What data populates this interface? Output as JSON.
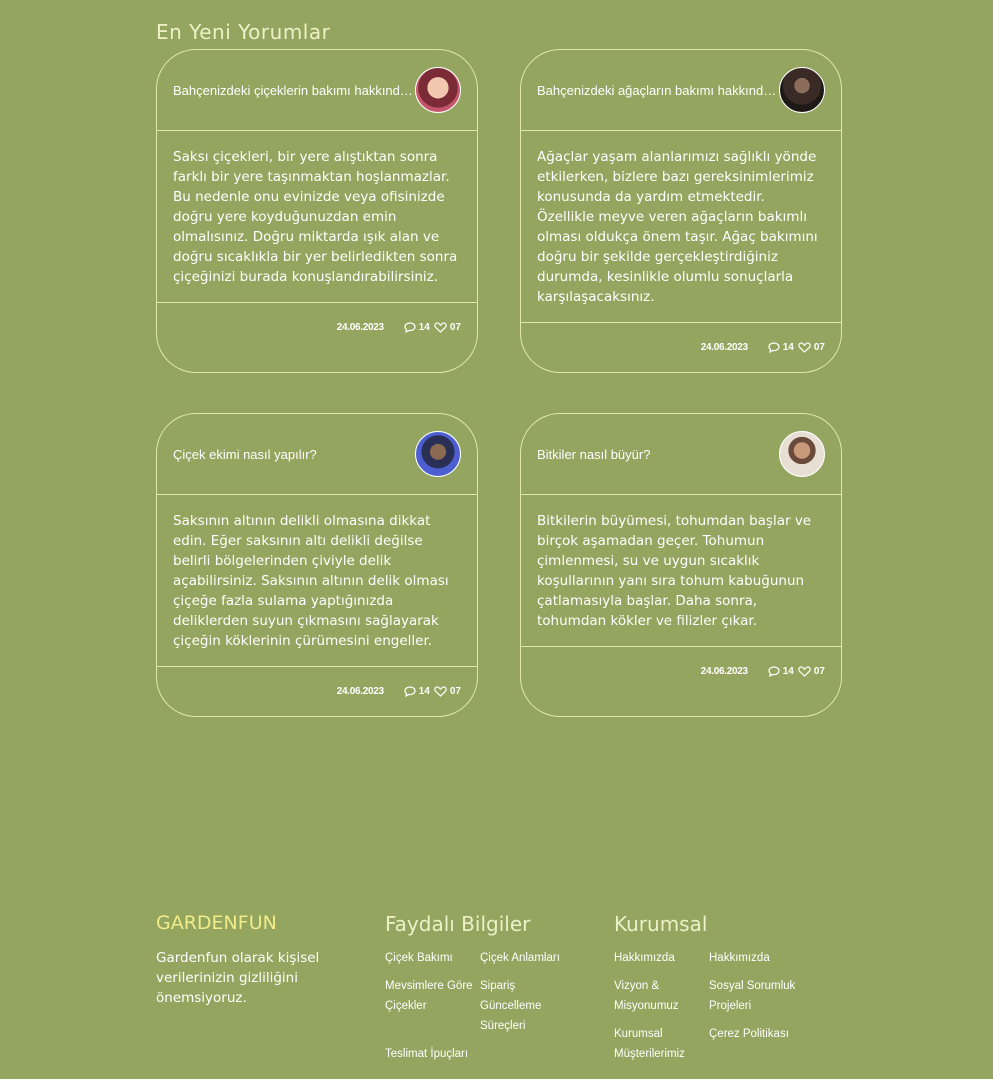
{
  "section": {
    "title": "En Yeni Yorumlar"
  },
  "cards": [
    {
      "title": "Bahçenizdeki çiçeklerin bakımı hakkında...",
      "avatar_color": "#c4556a",
      "body": "Saksı çiçekleri, bir yere alıştıktan sonra farklı bir yere taşınmaktan hoşlanmazlar. Bu nedenle onu evinizde veya ofisinizde doğru yere koyduğunuzdan emin olmalısınız. Doğru miktarda ışık alan ve doğru sıcaklıkla bir yer belirledikten sonra çiçeğinizi burada konuşlandırabilirsiniz.",
      "date": "24.06.2023",
      "comments": "14",
      "likes": "07"
    },
    {
      "title": "Bahçenizdeki ağaçların bakımı hakkında...",
      "avatar_color": "#2a2222",
      "body": "Ağaçlar yaşam alanlarımızı sağlıklı yönde etkilerken, bizlere bazı gereksinimlerimiz konusunda da yardım etmektedir. Özellikle meyve veren ağaçların bakımlı olması oldukça önem taşır. Ağaç bakımını doğru bir şekilde gerçekleştirdiğiniz durumda, kesinlikle olumlu sonuçlarla karşılaşacaksınız.",
      "date": "24.06.2023",
      "comments": "14",
      "likes": "07"
    },
    {
      "title": "Çiçek ekimi nasıl yapılır?",
      "avatar_color": "#3a4aa0",
      "body": "Saksının altının delikli olmasına dikkat edin. Eğer saksının altı delikli değilse belirli bölgelerinden çiviyle delik açabilirsiniz. Saksının altının delik olması çiçeğe fazla sulama yaptığınızda deliklerden suyun çıkmasını sağlayarak çiçeğin köklerinin çürümesini engeller.",
      "date": "24.06.2023",
      "comments": "14",
      "likes": "07"
    },
    {
      "title": "Bitkiler nasıl büyür?",
      "avatar_color": "#d9c9b5",
      "body": "Bitkilerin büyümesi, tohumdan başlar ve birçok aşamadan geçer. Tohumun çimlenmesi, su ve uygun sıcaklık koşullarının yanı sıra tohum kabuğunun çatlamasıyla başlar. Daha sonra, tohumdan kökler ve filizler çıkar.",
      "date": "24.06.2023",
      "comments": "14",
      "likes": "07"
    }
  ],
  "footer": {
    "brand": "GARDENFUN",
    "description": "Gardenfun olarak kişisel verilerinizin gizliliğini önemsiyoruz.",
    "useful": {
      "title": "Faydalı Bilgiler",
      "links": [
        "Çiçek Bakımı",
        "Çiçek Anlamları",
        "Mevsimlere Göre Çiçekler",
        "Sipariş Güncelleme Süreçleri",
        "Teslimat İpuçları"
      ]
    },
    "corporate": {
      "title": "Kurumsal",
      "links": [
        "Hakkımızda",
        "Hakkımızda",
        "Vizyon & Misyonumuz",
        "Sosyal Sorumluk Projeleri",
        "Kurumsal Müşterilerimiz",
        "Çerez Politikası"
      ]
    }
  }
}
